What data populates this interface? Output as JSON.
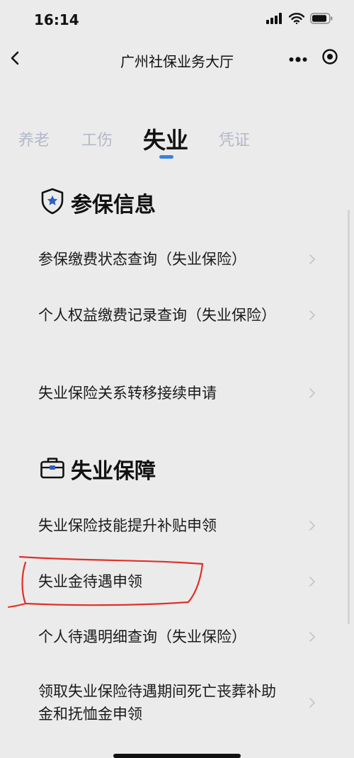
{
  "status_bar": {
    "time": "16:14",
    "icons": [
      "cellular-signal-icon",
      "wifi-icon",
      "battery-icon"
    ]
  },
  "nav": {
    "title": "广州社保业务大厅",
    "back_icon": "chevron-left-icon",
    "more_icon": "more-dots-icon",
    "close_icon": "target-close-icon"
  },
  "tabs": [
    {
      "label": "养老",
      "active": false
    },
    {
      "label": "工伤",
      "active": false
    },
    {
      "label": "失业",
      "active": true
    },
    {
      "label": "凭证",
      "active": false
    }
  ],
  "sections": [
    {
      "title": "参保信息",
      "icon": "shield-star-icon",
      "items": [
        {
          "label": "参保缴费状态查询（失业保险）"
        },
        {
          "label": "个人权益缴费记录查询（失业保险）"
        },
        {
          "label": "失业保险关系转移接续申请"
        }
      ]
    },
    {
      "title": "失业保障",
      "icon": "briefcase-icon",
      "items": [
        {
          "label": "失业保险技能提升补贴申领"
        },
        {
          "label": "失业金待遇申领"
        },
        {
          "label": "个人待遇明细查询（失业保险）"
        },
        {
          "label": "领取失业保险待遇期间死亡丧葬补助金和抚恤金申领"
        }
      ]
    }
  ],
  "colors": {
    "background": "#ebebeb",
    "tab_active": "#111111",
    "tab_inactive": "#b3b8c8",
    "indicator": "#3b7fe0",
    "annotation": "#e0302a"
  }
}
